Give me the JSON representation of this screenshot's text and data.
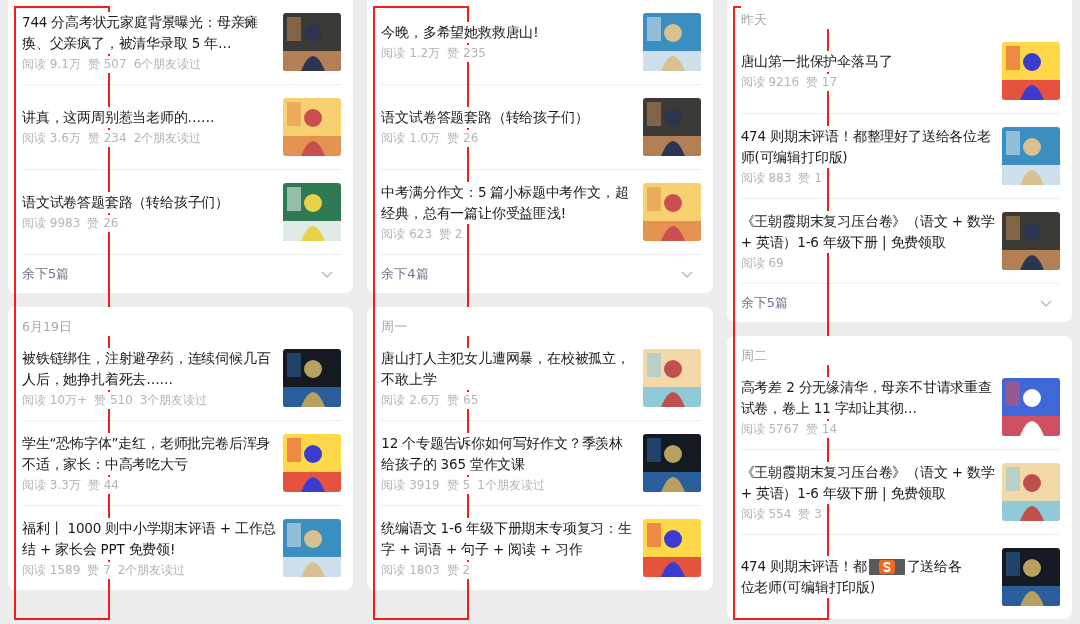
{
  "columns": [
    {
      "highlighted": true,
      "cards": [
        {
          "items": [
            {
              "title": "744 分高考状元家庭背景曝光：母亲瘫痪、父亲疯了，被清华录取 5 年…",
              "reads": "阅读 9.1万",
              "likes": "赞 507",
              "friends": "6个朋友读过"
            },
            {
              "title": "讲真，这两周别惹当老师的……",
              "reads": "阅读 3.6万",
              "likes": "赞 234",
              "friends": "2个朋友读过"
            },
            {
              "title": "语文试卷答题套路（转给孩子们）",
              "reads": "阅读 9983",
              "likes": "赞 26"
            }
          ],
          "more": "余下5篇"
        },
        {
          "date": "6月19日",
          "items": [
            {
              "title": "被铁链绑住，注射避孕药，连续伺候几百人后，她挣扎着死去……",
              "reads": "阅读 10万+",
              "likes": "赞 510",
              "friends": "3个朋友读过"
            },
            {
              "title": "学生“恐怖字体”走红，老师批完卷后浑身不适，家长：中高考吃大亏",
              "reads": "阅读 3.3万",
              "likes": "赞 44"
            },
            {
              "title": "福利丨 1000 则中小学期末评语 + 工作总结 + 家长会 PPT 免费领!",
              "reads": "阅读 1589",
              "likes": "赞 7",
              "friends": "2个朋友读过"
            }
          ]
        }
      ]
    },
    {
      "highlighted": true,
      "cards": [
        {
          "items": [
            {
              "title": "今晚，多希望她救救唐山!",
              "reads": "阅读 1.2万",
              "likes": "赞 235"
            },
            {
              "title": "语文试卷答题套路（转给孩子们）",
              "reads": "阅读 1.0万",
              "likes": "赞 26"
            },
            {
              "title": "中考满分作文：5 篇小标题中考作文，超经典，总有一篇让你受益匪浅!",
              "reads": "阅读 623",
              "likes": "赞 2"
            }
          ],
          "more": "余下4篇"
        },
        {
          "date": "周一",
          "items": [
            {
              "title": "唐山打人主犯女儿遭网暴，在校被孤立，不敢上学",
              "reads": "阅读 2.6万",
              "likes": "赞 65"
            },
            {
              "title": "12 个专题告诉你如何写好作文？季羡林给孩子的 365 堂作文课",
              "reads": "阅读 3919",
              "likes": "赞 5",
              "friends": "1个朋友读过"
            },
            {
              "title": "统编语文 1-6 年级下册期末专项复习：生字 + 词语 + 句子 + 阅读 + 习作",
              "reads": "阅读 1803",
              "likes": "赞 2"
            }
          ]
        }
      ]
    },
    {
      "highlighted": true,
      "cards": [
        {
          "date": "昨天",
          "items": [
            {
              "title": "唐山第一批保护伞落马了",
              "reads": "阅读 9216",
              "likes": "赞 17"
            },
            {
              "title": "474 则期末评语！都整理好了送给各位老师(可编辑打印版)",
              "reads": "阅读 883",
              "likes": "赞 1"
            },
            {
              "title": "《王朝霞期末复习压台卷》（语文 + 数学 + 英语）1-6 年级下册 | 免费领取",
              "reads": "阅读 69"
            }
          ],
          "more": "余下5篇"
        },
        {
          "date": "周二",
          "items": [
            {
              "title": "高考差 2 分无缘清华，母亲不甘请求重查试卷，卷上 11 字却让其彻…",
              "reads": "阅读 5767",
              "likes": "赞 14"
            },
            {
              "title": "《王朝霞期末复习压台卷》（语文 + 数学 + 英语）1-6 年级下册 | 免费领取",
              "reads": "阅读 554",
              "likes": "赞 3"
            },
            {
              "title": "474 则期末评语！都",
              "title_rest": "了送给各",
              "title_line2": "位老师(可编辑打印版)",
              "ime_toolbar": true
            }
          ]
        }
      ]
    }
  ]
}
